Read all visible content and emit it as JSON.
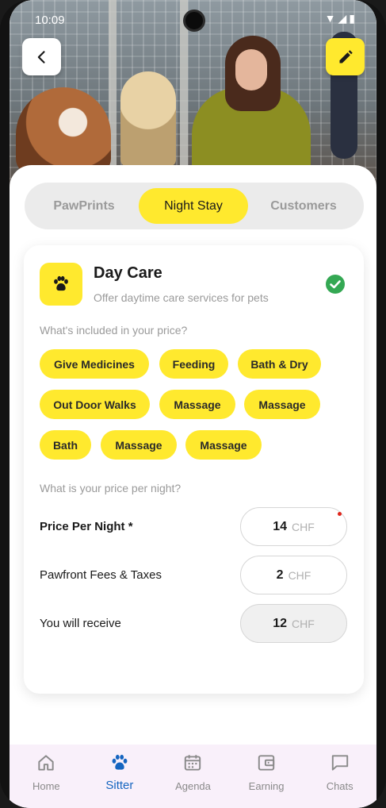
{
  "status_bar": {
    "time": "10:09"
  },
  "tabs": [
    {
      "label": "PawPrints",
      "active": false
    },
    {
      "label": "Night Stay",
      "active": true
    },
    {
      "label": "Customers",
      "active": false
    }
  ],
  "service": {
    "title": "Day Care",
    "subtitle": "Offer daytime care services for pets",
    "selected": true
  },
  "included": {
    "question": "What's included in your price?",
    "chips": [
      "Give Medicines",
      "Feeding",
      "Bath & Dry",
      "Out Door Walks",
      "Massage",
      "Massage",
      "Bath",
      "Massage",
      "Massage"
    ]
  },
  "pricing": {
    "question": "What is your price per night?",
    "rows": [
      {
        "label": "Price Per Night *",
        "value": "14",
        "unit": "CHF"
      },
      {
        "label": "Pawfront Fees & Taxes",
        "value": "2",
        "unit": "CHF"
      },
      {
        "label": "You will receive",
        "value": "12",
        "unit": "CHF"
      }
    ]
  },
  "bottom_nav": [
    {
      "label": "Home",
      "icon": "home-icon",
      "active": false
    },
    {
      "label": "Sitter",
      "icon": "paw-icon",
      "active": true
    },
    {
      "label": "Agenda",
      "icon": "calendar-icon",
      "active": false
    },
    {
      "label": "Earning",
      "icon": "wallet-icon",
      "active": false
    },
    {
      "label": "Chats",
      "icon": "chat-icon",
      "active": false
    }
  ],
  "colors": {
    "accent": "#ffe92e",
    "check": "#34a853",
    "nav_active": "#1565c0"
  }
}
